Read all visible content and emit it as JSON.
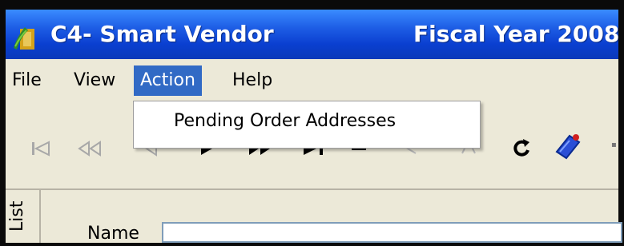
{
  "window": {
    "title": "C4- Smart Vendor",
    "fiscal_year_label": "Fiscal Year 2008"
  },
  "menubar": {
    "items": [
      {
        "label": "File"
      },
      {
        "label": "View"
      },
      {
        "label": "Action"
      },
      {
        "label": "Help"
      }
    ]
  },
  "dropdown": {
    "items": [
      {
        "label": "Pending Order Addresses"
      }
    ]
  },
  "toolbar": {
    "icons": [
      "first-record-icon",
      "prev-page-icon",
      "prev-record-icon",
      "next-record-icon",
      "next-page-icon",
      "last-record-icon",
      "delete-record-icon",
      "undo-icon",
      "cancel-icon",
      "refresh-icon",
      "tag-icon"
    ]
  },
  "content": {
    "side_tab_label": "List",
    "name_label": "Name",
    "name_value": ""
  },
  "colors": {
    "titlebar_blue": "#0a3fd0",
    "menu_highlight": "#316ac5",
    "face": "#ece9d8"
  }
}
